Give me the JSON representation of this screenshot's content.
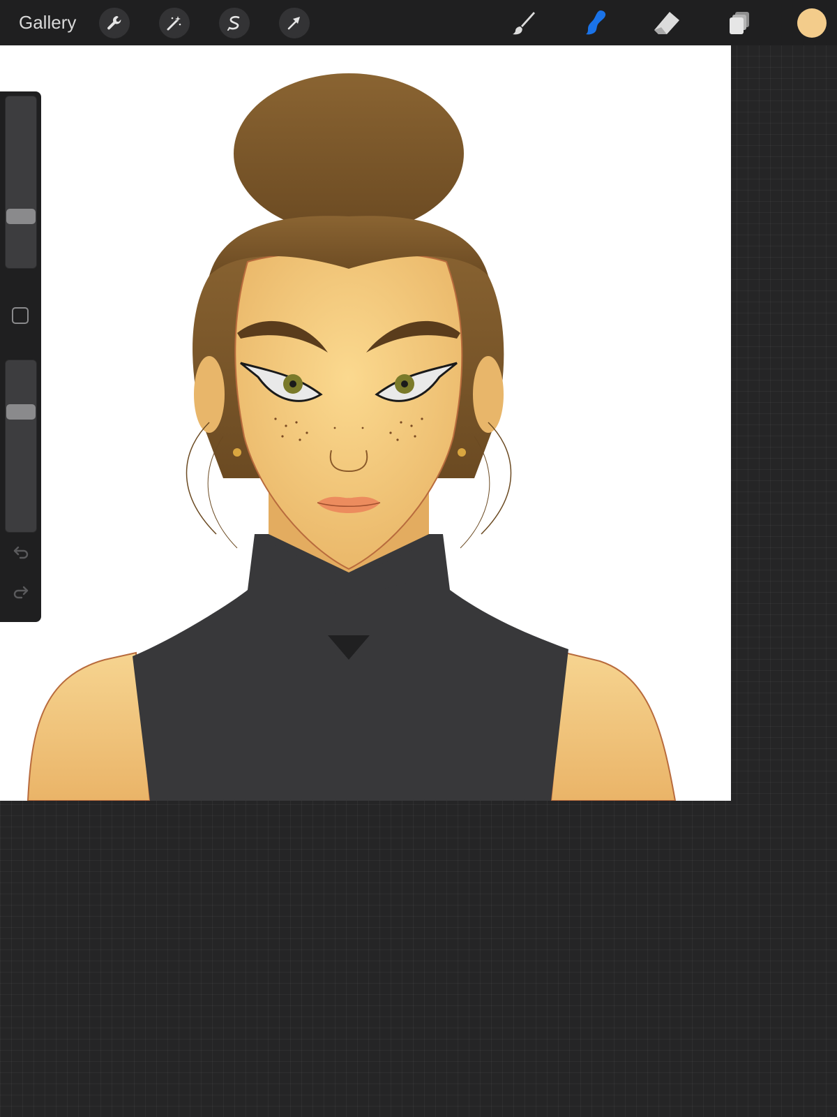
{
  "topbar": {
    "gallery_label": "Gallery",
    "left_tools": [
      "wrench-icon",
      "magic-wand-icon",
      "selection-icon",
      "transform-arrow-icon"
    ],
    "right_tools": [
      "paintbrush-icon",
      "smudge-icon",
      "eraser-icon",
      "layers-icon"
    ],
    "active_tool": "smudge",
    "active_color": "#f3cc8b",
    "accent_color": "#1a73e8"
  },
  "sidebar": {
    "brush_size_level": 0.28,
    "brush_opacity_level": 0.72,
    "icons": [
      "modify-square-icon",
      "undo-icon",
      "redo-icon"
    ]
  },
  "canvas": {
    "background": "#ffffff",
    "artwork": "portrait"
  }
}
